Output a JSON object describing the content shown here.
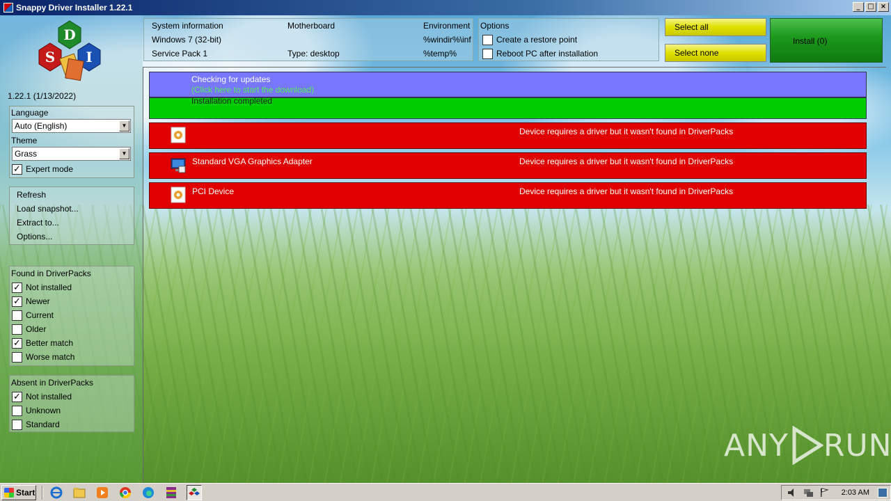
{
  "window": {
    "title": "Snappy Driver Installer 1.22.1",
    "min": "_",
    "max": "□",
    "close": "×"
  },
  "logo": {
    "letters": [
      "D",
      "S",
      "I"
    ]
  },
  "version": "1.22.1 (1/13/2022)",
  "settings": {
    "language_label": "Language",
    "language_value": "Auto (English)",
    "theme_label": "Theme",
    "theme_value": "Grass",
    "expert_mode": {
      "label": "Expert mode",
      "checked": true
    }
  },
  "actions": [
    "Refresh",
    "Load snapshot...",
    "Extract to...",
    "Options..."
  ],
  "found": {
    "header": "Found in DriverPacks",
    "items": [
      {
        "label": "Not installed",
        "checked": true
      },
      {
        "label": "Newer",
        "checked": true
      },
      {
        "label": "Current",
        "checked": false
      },
      {
        "label": "Older",
        "checked": false
      },
      {
        "label": "Better match",
        "checked": true
      },
      {
        "label": "Worse match",
        "checked": false
      }
    ]
  },
  "absent": {
    "header": "Absent in DriverPacks",
    "items": [
      {
        "label": "Not installed",
        "checked": true
      },
      {
        "label": "Unknown",
        "checked": false
      },
      {
        "label": "Standard",
        "checked": false
      }
    ]
  },
  "sysinfo": {
    "col1": [
      "System information",
      "Windows 7 (32-bit)",
      "Service Pack 1"
    ],
    "col2": [
      "Motherboard",
      "",
      "Type: desktop"
    ],
    "col3": [
      "Environment",
      "%windir%\\inf",
      "%temp%"
    ]
  },
  "options": {
    "header": "Options",
    "restore_point": {
      "label": "Create a restore point",
      "checked": false
    },
    "reboot": {
      "label": "Reboot PC after installation",
      "checked": false
    }
  },
  "buttons": {
    "select_all": "Select all",
    "select_none": "Select none",
    "install": "Install (0)"
  },
  "status": {
    "checking": "Checking for updates",
    "click_here": "(Click here to start the download)",
    "completed": "Installation completed"
  },
  "devices": [
    {
      "name": "",
      "message": "Device requires a driver but it wasn't found in DriverPacks",
      "icon": "gear-icon"
    },
    {
      "name": "Standard VGA Graphics Adapter",
      "message": "Device requires a driver but it wasn't found in DriverPacks",
      "icon": "monitor-icon"
    },
    {
      "name": "PCI Device",
      "message": "Device requires a driver but it wasn't found in DriverPacks",
      "icon": "gear-icon"
    }
  ],
  "watermark": {
    "text_left": "ANY",
    "text_right": "RUN"
  },
  "taskbar": {
    "start": "Start",
    "clock": "2:03 AM"
  },
  "colors": {
    "update_bar": "#7777ff",
    "completed_bar": "#00cc00",
    "missing_driver": "#e00000",
    "select_btn": "#e0e000",
    "install_btn": "#1d9a1d"
  }
}
